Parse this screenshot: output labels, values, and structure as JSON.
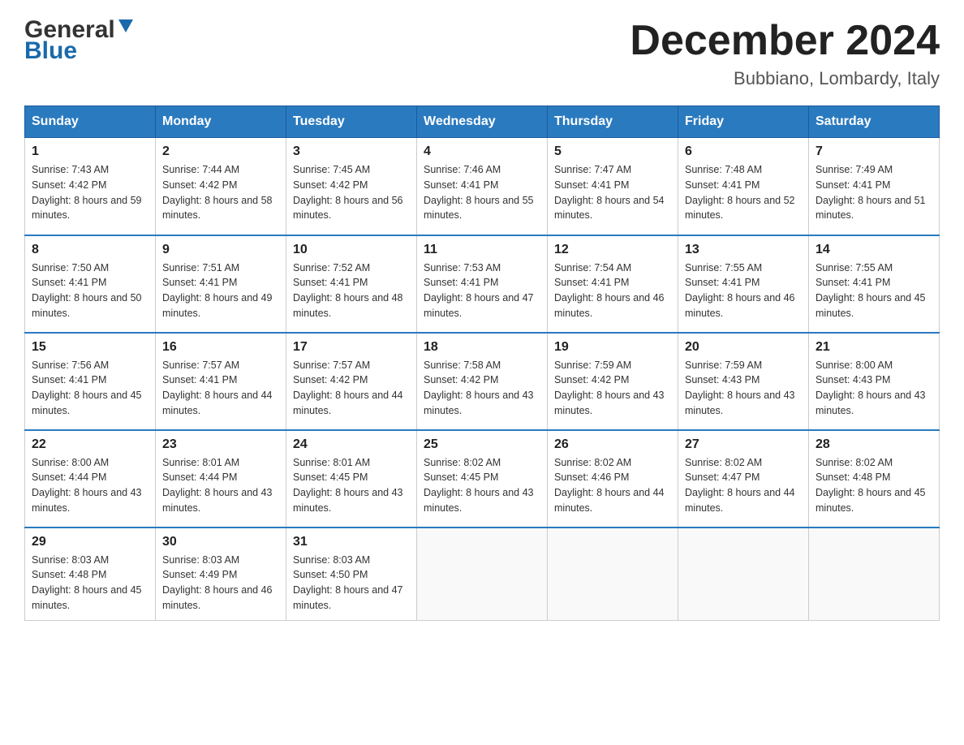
{
  "header": {
    "logo_general": "General",
    "logo_blue": "Blue",
    "month_title": "December 2024",
    "location": "Bubbiano, Lombardy, Italy"
  },
  "days_of_week": [
    "Sunday",
    "Monday",
    "Tuesday",
    "Wednesday",
    "Thursday",
    "Friday",
    "Saturday"
  ],
  "weeks": [
    [
      {
        "day": "1",
        "sunrise": "7:43 AM",
        "sunset": "4:42 PM",
        "daylight": "8 hours and 59 minutes."
      },
      {
        "day": "2",
        "sunrise": "7:44 AM",
        "sunset": "4:42 PM",
        "daylight": "8 hours and 58 minutes."
      },
      {
        "day": "3",
        "sunrise": "7:45 AM",
        "sunset": "4:42 PM",
        "daylight": "8 hours and 56 minutes."
      },
      {
        "day": "4",
        "sunrise": "7:46 AM",
        "sunset": "4:41 PM",
        "daylight": "8 hours and 55 minutes."
      },
      {
        "day": "5",
        "sunrise": "7:47 AM",
        "sunset": "4:41 PM",
        "daylight": "8 hours and 54 minutes."
      },
      {
        "day": "6",
        "sunrise": "7:48 AM",
        "sunset": "4:41 PM",
        "daylight": "8 hours and 52 minutes."
      },
      {
        "day": "7",
        "sunrise": "7:49 AM",
        "sunset": "4:41 PM",
        "daylight": "8 hours and 51 minutes."
      }
    ],
    [
      {
        "day": "8",
        "sunrise": "7:50 AM",
        "sunset": "4:41 PM",
        "daylight": "8 hours and 50 minutes."
      },
      {
        "day": "9",
        "sunrise": "7:51 AM",
        "sunset": "4:41 PM",
        "daylight": "8 hours and 49 minutes."
      },
      {
        "day": "10",
        "sunrise": "7:52 AM",
        "sunset": "4:41 PM",
        "daylight": "8 hours and 48 minutes."
      },
      {
        "day": "11",
        "sunrise": "7:53 AM",
        "sunset": "4:41 PM",
        "daylight": "8 hours and 47 minutes."
      },
      {
        "day": "12",
        "sunrise": "7:54 AM",
        "sunset": "4:41 PM",
        "daylight": "8 hours and 46 minutes."
      },
      {
        "day": "13",
        "sunrise": "7:55 AM",
        "sunset": "4:41 PM",
        "daylight": "8 hours and 46 minutes."
      },
      {
        "day": "14",
        "sunrise": "7:55 AM",
        "sunset": "4:41 PM",
        "daylight": "8 hours and 45 minutes."
      }
    ],
    [
      {
        "day": "15",
        "sunrise": "7:56 AM",
        "sunset": "4:41 PM",
        "daylight": "8 hours and 45 minutes."
      },
      {
        "day": "16",
        "sunrise": "7:57 AM",
        "sunset": "4:41 PM",
        "daylight": "8 hours and 44 minutes."
      },
      {
        "day": "17",
        "sunrise": "7:57 AM",
        "sunset": "4:42 PM",
        "daylight": "8 hours and 44 minutes."
      },
      {
        "day": "18",
        "sunrise": "7:58 AM",
        "sunset": "4:42 PM",
        "daylight": "8 hours and 43 minutes."
      },
      {
        "day": "19",
        "sunrise": "7:59 AM",
        "sunset": "4:42 PM",
        "daylight": "8 hours and 43 minutes."
      },
      {
        "day": "20",
        "sunrise": "7:59 AM",
        "sunset": "4:43 PM",
        "daylight": "8 hours and 43 minutes."
      },
      {
        "day": "21",
        "sunrise": "8:00 AM",
        "sunset": "4:43 PM",
        "daylight": "8 hours and 43 minutes."
      }
    ],
    [
      {
        "day": "22",
        "sunrise": "8:00 AM",
        "sunset": "4:44 PM",
        "daylight": "8 hours and 43 minutes."
      },
      {
        "day": "23",
        "sunrise": "8:01 AM",
        "sunset": "4:44 PM",
        "daylight": "8 hours and 43 minutes."
      },
      {
        "day": "24",
        "sunrise": "8:01 AM",
        "sunset": "4:45 PM",
        "daylight": "8 hours and 43 minutes."
      },
      {
        "day": "25",
        "sunrise": "8:02 AM",
        "sunset": "4:45 PM",
        "daylight": "8 hours and 43 minutes."
      },
      {
        "day": "26",
        "sunrise": "8:02 AM",
        "sunset": "4:46 PM",
        "daylight": "8 hours and 44 minutes."
      },
      {
        "day": "27",
        "sunrise": "8:02 AM",
        "sunset": "4:47 PM",
        "daylight": "8 hours and 44 minutes."
      },
      {
        "day": "28",
        "sunrise": "8:02 AM",
        "sunset": "4:48 PM",
        "daylight": "8 hours and 45 minutes."
      }
    ],
    [
      {
        "day": "29",
        "sunrise": "8:03 AM",
        "sunset": "4:48 PM",
        "daylight": "8 hours and 45 minutes."
      },
      {
        "day": "30",
        "sunrise": "8:03 AM",
        "sunset": "4:49 PM",
        "daylight": "8 hours and 46 minutes."
      },
      {
        "day": "31",
        "sunrise": "8:03 AM",
        "sunset": "4:50 PM",
        "daylight": "8 hours and 47 minutes."
      },
      null,
      null,
      null,
      null
    ]
  ]
}
